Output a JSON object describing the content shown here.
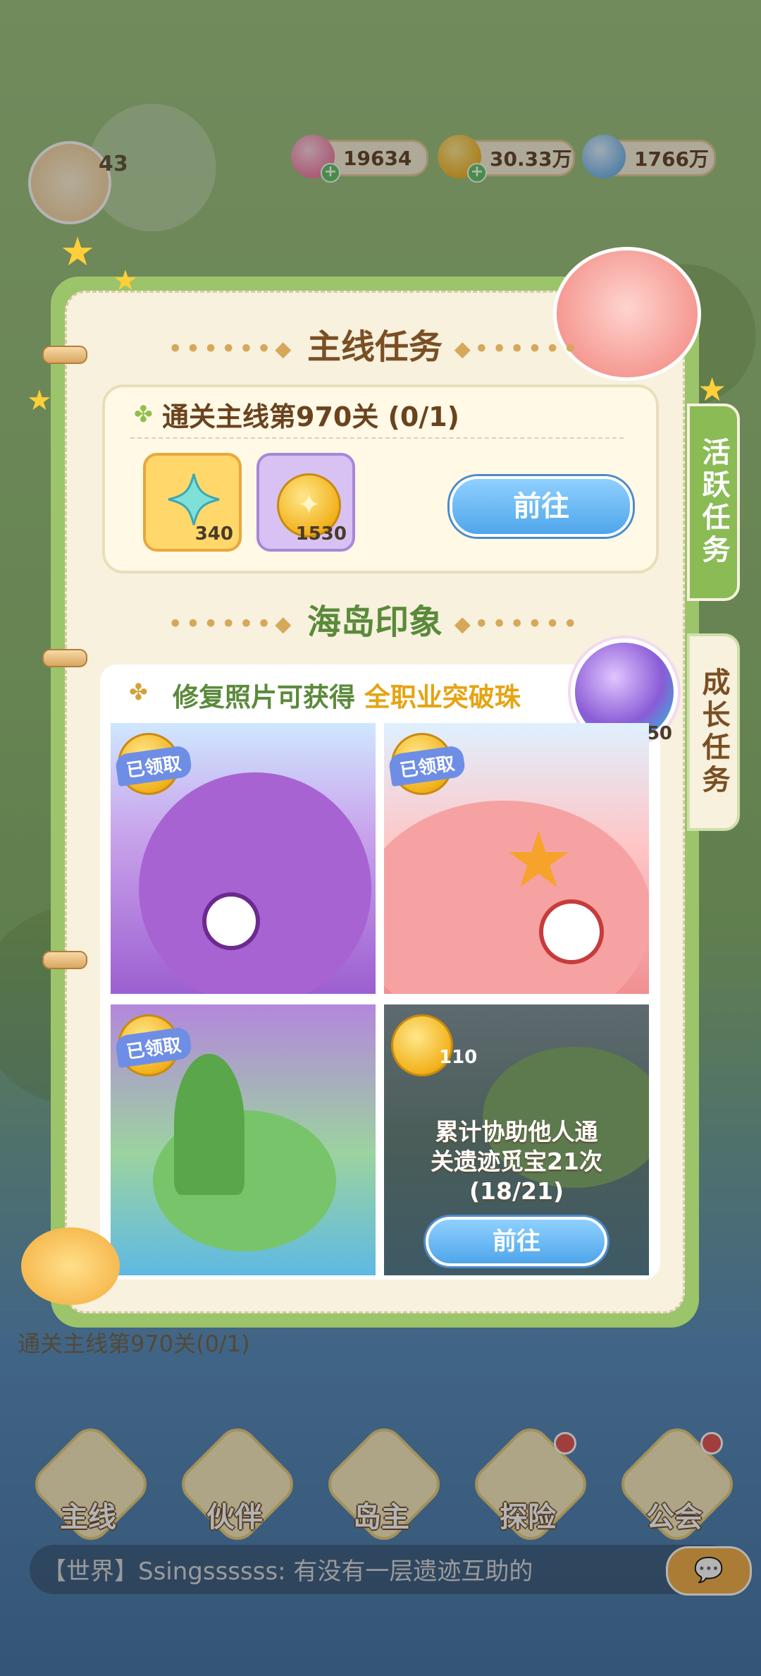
{
  "currencies": [
    {
      "name": "diamond-icon",
      "value": "19634",
      "color": "#f07aa0"
    },
    {
      "name": "gold-coin-icon",
      "value": "30.33万",
      "color": "#f2b21d"
    },
    {
      "name": "crossed-swords-icon",
      "value": "1766万",
      "color": "#6fb4ea"
    }
  ],
  "player": {
    "level": "43"
  },
  "panel": {
    "main_task_title": "主线任务",
    "main_task": {
      "text": "通关主线第970关 (0/1)",
      "rewards": [
        {
          "icon": "star-gem-icon",
          "count": "340"
        },
        {
          "icon": "gold-coin-icon",
          "count": "1530"
        }
      ],
      "go_label": "前往"
    },
    "island_title": "海岛印象",
    "island": {
      "hint_prefix": "修复照片可获得",
      "hint_highlight": "全职业突破珠",
      "badge_count": "50",
      "tiles": [
        {
          "state": "已领取"
        },
        {
          "state": "已领取"
        },
        {
          "state": "已领取"
        },
        {
          "coin_count": "110",
          "task_line1": "累计协助他人通",
          "task_line2": "关遗迹觅宝21次",
          "task_progress": "(18/21)",
          "go_label": "前往"
        }
      ]
    }
  },
  "side_tabs": {
    "active": "活跃任务",
    "inactive": "成长任务"
  },
  "nav": [
    {
      "label": "主线"
    },
    {
      "label": "伙伴"
    },
    {
      "label": "岛主"
    },
    {
      "label": "探险"
    },
    {
      "label": "公会"
    }
  ],
  "chat": {
    "text": "【世界】Ssingssssss: 有没有一层遗迹互助的"
  },
  "behind_text": "通关主线第970关(0/1)",
  "accent": {
    "green": "#8bbb55",
    "brown": "#7a4f23",
    "blue": "#4fa6ea",
    "gold": "#e5a413"
  }
}
